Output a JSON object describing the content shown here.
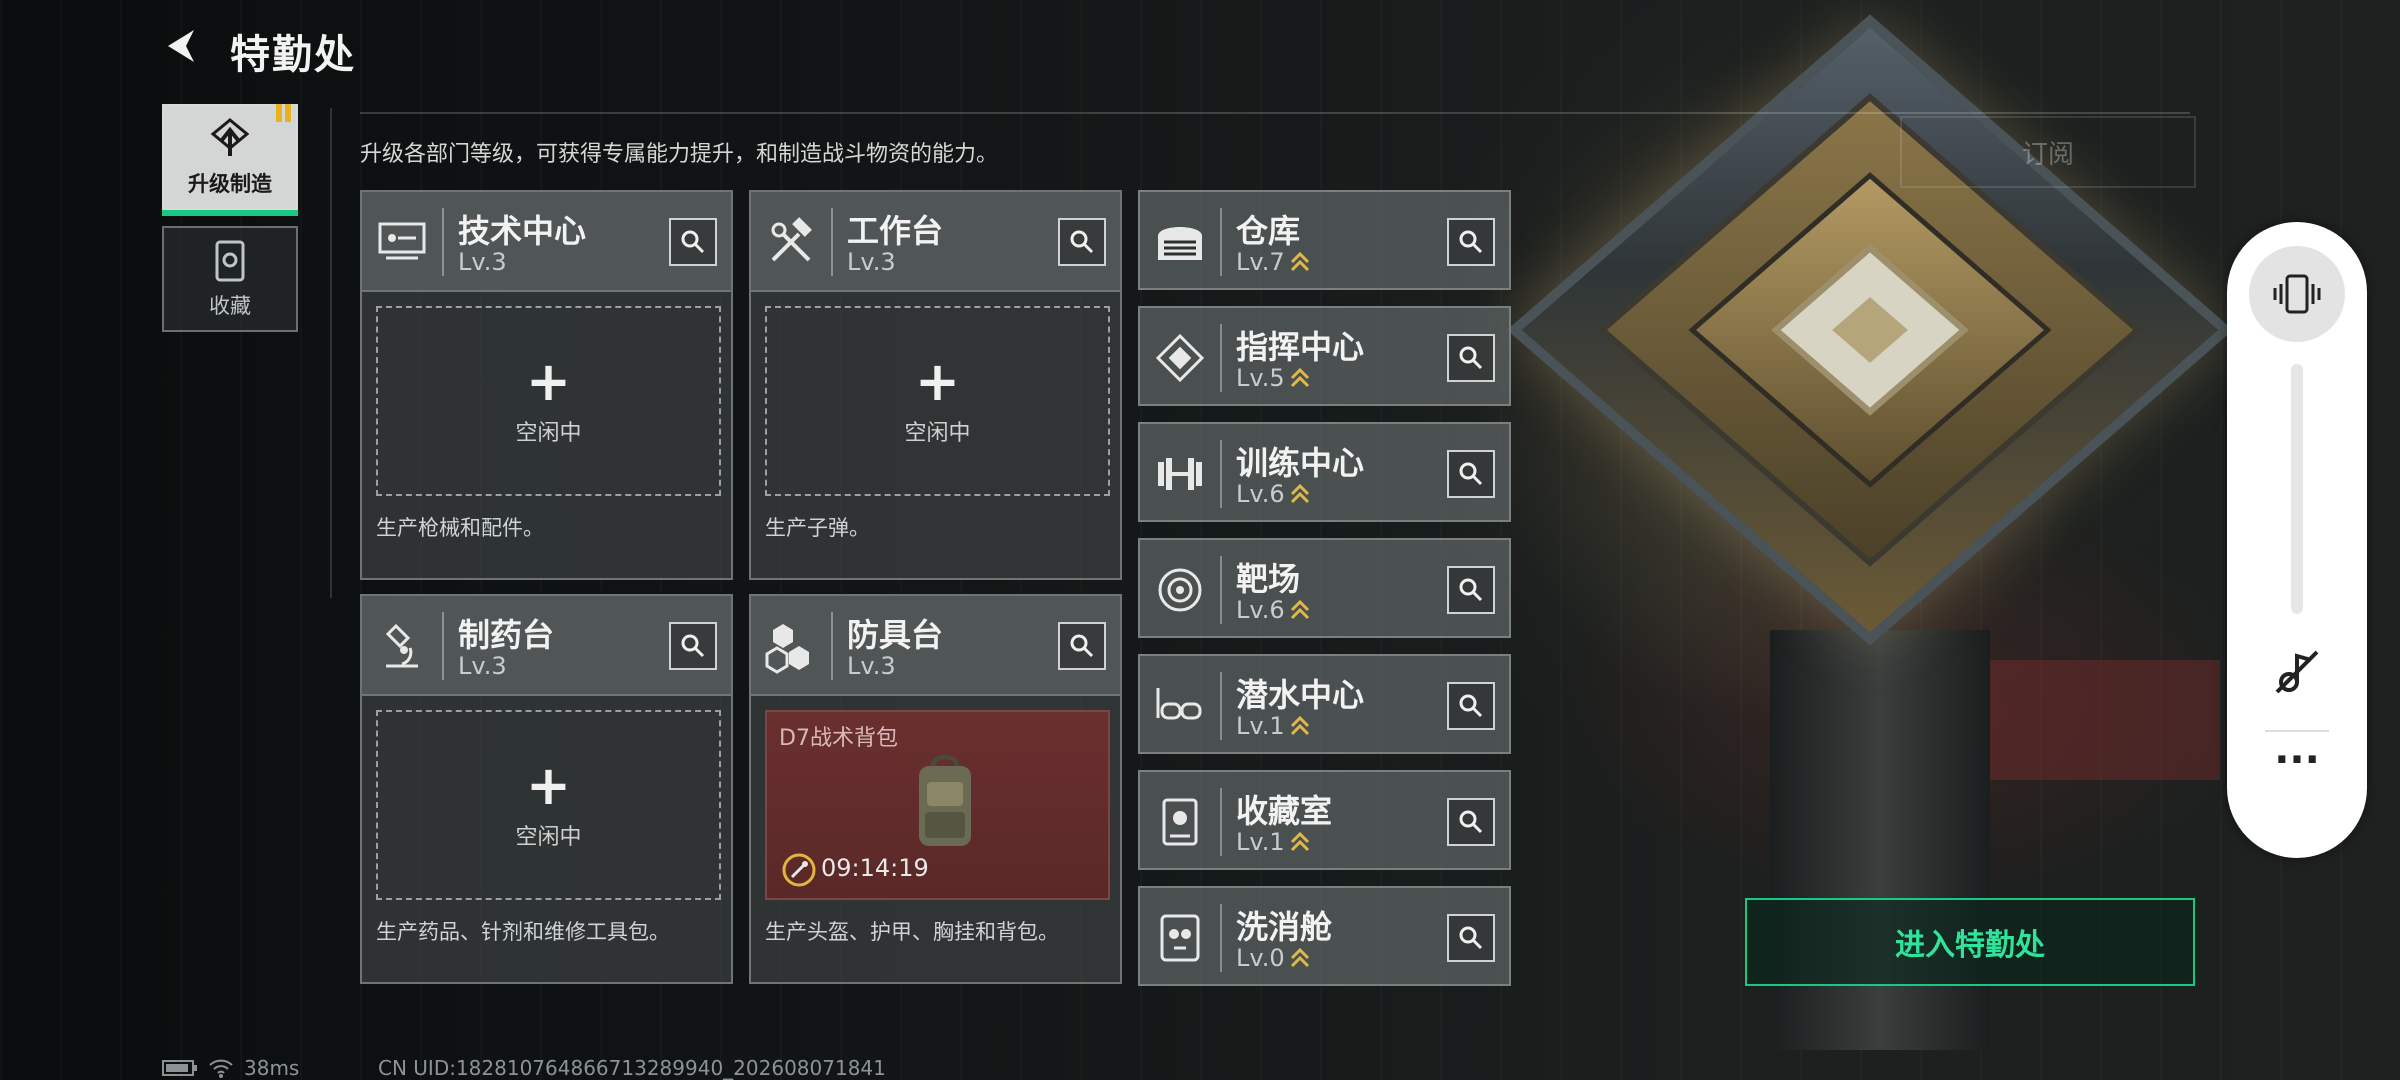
{
  "header": {
    "title": "特勤处",
    "back_icon": "back-arrow-icon"
  },
  "tabs": [
    {
      "label": "升级制造",
      "icon": "upgrade-icon",
      "active": true
    },
    {
      "label": "收藏",
      "icon": "collection-icon",
      "active": false
    }
  ],
  "description": "升级各部门等级，可获得专属能力提升，和制造战斗物资的能力。",
  "ghost_button": "订阅",
  "departments": [
    {
      "name": "技术中心",
      "level": "Lv.3",
      "icon": "monitor-icon",
      "slot_plus": "+",
      "slot_status": "空闲中",
      "footer": "生产枪械和配件。"
    },
    {
      "name": "工作台",
      "level": "Lv.3",
      "icon": "hammer-wrench-icon",
      "slot_plus": "+",
      "slot_status": "空闲中",
      "footer": "生产子弹。"
    },
    {
      "name": "制药台",
      "level": "Lv.3",
      "icon": "microscope-icon",
      "slot_plus": "+",
      "slot_status": "空闲中",
      "footer": "生产药品、针剂和维修工具包。"
    },
    {
      "name": "防具台",
      "level": "Lv.3",
      "icon": "armor-blocks-icon",
      "craft_item": "D7战术背包",
      "craft_timer": "09:14:19",
      "footer": "生产头盔、护甲、胸挂和背包。"
    }
  ],
  "facilities": [
    {
      "name": "仓库",
      "level": "Lv.7",
      "icon": "warehouse-icon"
    },
    {
      "name": "指挥中心",
      "level": "Lv.5",
      "icon": "chip-icon"
    },
    {
      "name": "训练中心",
      "level": "Lv.6",
      "icon": "dumbbell-icon"
    },
    {
      "name": "靶场",
      "level": "Lv.6",
      "icon": "target-icon"
    },
    {
      "name": "潜水中心",
      "level": "Lv.1",
      "icon": "goggles-icon"
    },
    {
      "name": "收藏室",
      "level": "Lv.1",
      "icon": "display-case-icon"
    },
    {
      "name": "洗消舱",
      "level": "Lv.0",
      "icon": "hazmat-icon"
    }
  ],
  "enter_button": "进入特勤处",
  "status": {
    "ping": "38ms",
    "uid": "CN UID:1828107648667132899​40_20260807184​1"
  },
  "overlay": {
    "more": "···"
  },
  "colors": {
    "accent": "#19c982",
    "tab_flag": "#e6b21d",
    "craft_bg": "#6a2f2f"
  }
}
